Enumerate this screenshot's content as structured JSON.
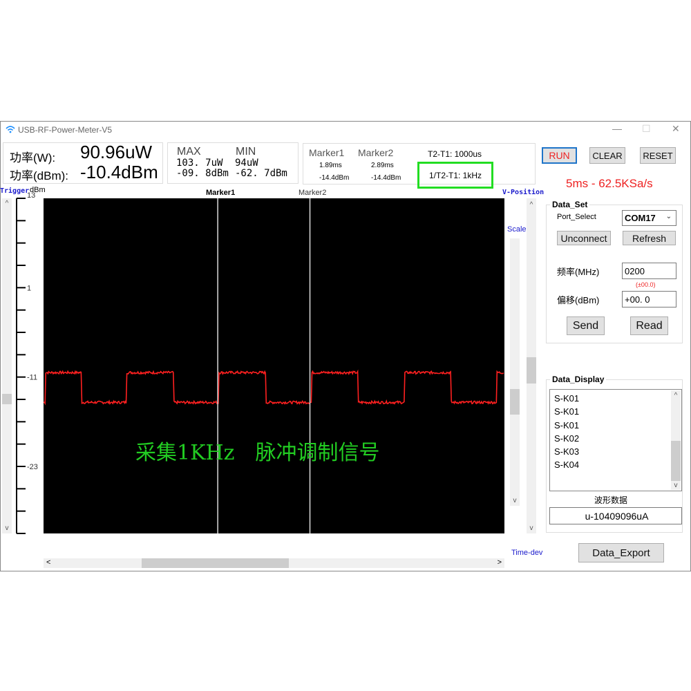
{
  "window": {
    "title": "USB-RF-Power-Meter-V5",
    "minimize": "—",
    "maximize": "☐",
    "close": "✕"
  },
  "readout": {
    "w_label": "功率(W):",
    "w_value": "90.96uW",
    "dbm_label": "功率(dBm):",
    "dbm_value": "-10.4dBm"
  },
  "minmax": {
    "max_label": "MAX",
    "max_w": "103. 7uW",
    "max_dbm": "-09. 8dBm",
    "min_label": "MIN",
    "min_w": "94uW",
    "min_dbm": "-62. 7dBm"
  },
  "markers": {
    "m1_label": "Marker1",
    "m1_time": "1.89ms",
    "m1_dbm": "-14.4dBm",
    "m2_label": "Marker2",
    "m2_time": "2.89ms",
    "m2_dbm": "-14.4dBm",
    "delta": "T2-T1: 1000us",
    "freq": "1/T2-T1: 1kHz"
  },
  "controls": {
    "run": "RUN",
    "clear": "CLEAR",
    "reset": "RESET",
    "rate": "5ms - 62.5KSa/s"
  },
  "plot": {
    "trigger": "Trigger",
    "unit": "dBm",
    "vpos": "V-Position",
    "scale": "Scale",
    "timedev": "Time-dev",
    "marker1": "Marker1",
    "marker2": "Marker2",
    "overlay": "采集1KHz　脉冲调制信号",
    "yticks": [
      "13",
      "1",
      "-11",
      "-23"
    ]
  },
  "data_set": {
    "label": "Data_Set",
    "port_label": "Port_Select",
    "port_value": "COM17",
    "unconnect": "Unconnect",
    "refresh": "Refresh",
    "freq_label": "频率(MHz)",
    "freq_value": "0200",
    "offset_hint": "(±00.0)",
    "offset_label": "偏移(dBm)",
    "offset_value": "+00. 0",
    "send": "Send",
    "read": "Read"
  },
  "data_display": {
    "label": "Data_Display",
    "items": [
      "S-K01",
      "S-K01",
      "S-K01",
      "S-K02",
      "S-K03",
      "S-K04"
    ],
    "wave_label": "波形数据",
    "wave_value": "u-10409096uA",
    "export": "Data_Export"
  },
  "colors": {
    "trace": "#ff2020",
    "overlay": "#22cc22",
    "highlight": "#22dd22",
    "rate": "#ee2222"
  },
  "chart_data": {
    "type": "line",
    "xlim": [
      0,
      5
    ],
    "x_unit": "ms",
    "ylim": [
      -32,
      13
    ],
    "ylabel": "dBm",
    "yticks": [
      13,
      1,
      -11,
      -23
    ],
    "high_dbm": -10.4,
    "low_dbm": -14.4,
    "period_ms": 1,
    "rising_edges_ms": [
      0.02,
      0.9,
      1.9,
      2.91,
      3.92,
      4.92
    ],
    "falling_edges_ms": [
      0.41,
      1.41,
      2.41,
      3.41,
      4.42
    ],
    "marker1_ms": 1.89,
    "marker2_ms": 2.89
  }
}
